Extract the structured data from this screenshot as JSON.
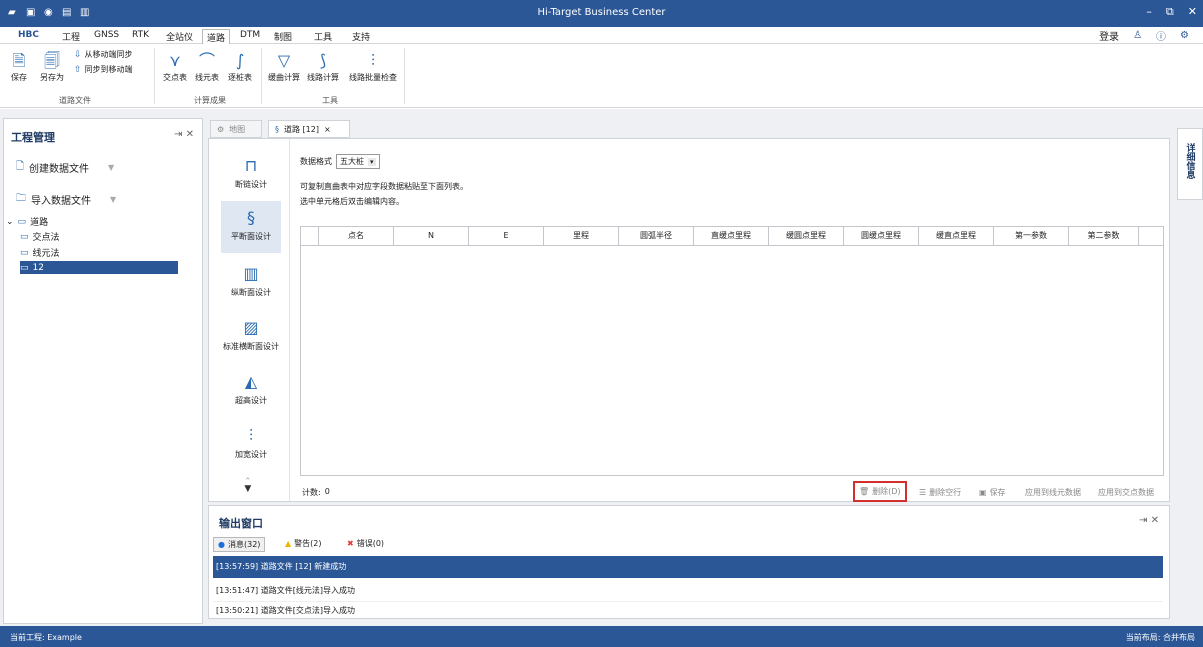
{
  "app_title": "Hi-Target Business Center",
  "window_controls": {
    "minimize": "–",
    "restore": "⧉",
    "close": "✕"
  },
  "menu_tabs": [
    "HBC",
    "工程",
    "GNSS",
    "RTK",
    "全站仪",
    "道路",
    "DTM",
    "制图",
    "工具",
    "支持"
  ],
  "active_menu_tab": "道路",
  "top_right": {
    "login": "登录"
  },
  "ribbon": {
    "save": "保存",
    "save_as": "另存为",
    "sync_from_mobile": "从移动端同步",
    "sync_to_mobile": "同步到移动端",
    "group_road_file": "道路文件",
    "intersection_table": "交点表",
    "line_element_table": "线元表",
    "station_table": "逐桩表",
    "group_calc_results": "计算成果",
    "curve_calc": "缓曲计算",
    "road_calc": "线路计算",
    "road_batch_check": "线路批量检查",
    "group_tools": "工具"
  },
  "left_panel": {
    "title": "工程管理",
    "create_data_file": "创建数据文件",
    "import_data_file": "导入数据文件",
    "tree": {
      "root": "道路",
      "children": [
        "交点法",
        "线元法",
        "12"
      ]
    }
  },
  "doc_tabs": {
    "map": "地图",
    "road": "道路 [12]",
    "close": "×"
  },
  "side_buttons": [
    "断链设计",
    "平断面设计",
    "纵断面设计",
    "标准横断面设计",
    "超高设计",
    "加宽设计"
  ],
  "data_format_label": "数据格式",
  "data_format_value": "五大桩",
  "hint1": "可复制直曲表中对应字段数据粘贴至下面列表。",
  "hint2": "选中单元格后双击编辑内容。",
  "table_headers": [
    "点名",
    "N",
    "E",
    "里程",
    "圆弧半径",
    "直缓点里程",
    "缓圆点里程",
    "圆缓点里程",
    "缓直点里程",
    "第一参数",
    "第二参数"
  ],
  "count_label": "计数:",
  "count_value": "0",
  "bottom_buttons": {
    "delete": "删除(D)",
    "delete_empty_rows": "删除空行",
    "save": "保存",
    "apply_line_element": "应用到线元数据",
    "apply_intersection": "应用到交点数据"
  },
  "detail_tab": "详细信息",
  "output": {
    "title": "输出窗口",
    "tabs": {
      "messages": "消息(32)",
      "warnings": "警告(2)",
      "errors": "错误(0)"
    },
    "lines": [
      "[13:57:59] 道路文件 [12] 新建成功",
      "[13:51:47] 道路文件[线元法]导入成功",
      "[13:50:21] 道路文件[交点法]导入成功"
    ]
  },
  "status": {
    "project": "当前工程: Example",
    "layout": "当前布局: 合并布局"
  },
  "colors": {
    "brand": "#2b5797",
    "highlight_border": "#d32f2f",
    "warning": "#f0b400",
    "error": "#e53935",
    "info": "#1e6fd9"
  }
}
